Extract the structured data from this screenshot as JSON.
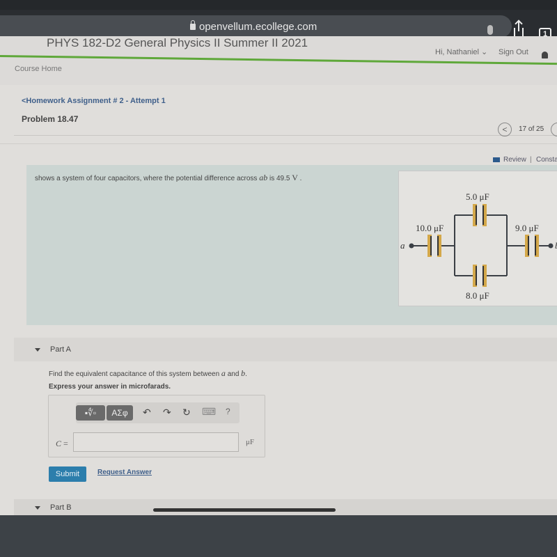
{
  "browser": {
    "url": "openvellum.ecollege.com",
    "tab_count": "1"
  },
  "header": {
    "course_title": "PHYS 182-D2 General Physics II Summer II 2021",
    "greeting": "Hi, Nathaniel ⌄",
    "sign_out": "Sign Out",
    "course_home": "Course Home",
    "accent_color": "#5fa83a"
  },
  "assignment": {
    "back_link": "<Homework Assignment # 2 - Attempt 1",
    "problem_title": "Problem 18.47",
    "pager": {
      "prev": "<",
      "position": "17 of 25"
    },
    "review_link": "Review",
    "separator": "|",
    "constants_link": "Consta"
  },
  "intro": {
    "text_before": "shows a system of four capacitors, where the potential difference across ",
    "var": "ab",
    "text_mid": " is 49.5 ",
    "unit": "V",
    "text_after": " ."
  },
  "figure": {
    "terminal_a": "a",
    "terminal_b": "b",
    "capacitors": [
      {
        "label": "10.0 μF",
        "position": "series-left"
      },
      {
        "label": "5.0 μF",
        "position": "parallel-top"
      },
      {
        "label": "8.0 μF",
        "position": "parallel-bottom"
      },
      {
        "label": "9.0 μF",
        "position": "series-right"
      }
    ]
  },
  "partA": {
    "label": "Part A",
    "question_before": "Find the equivalent capacitance of this system between ",
    "var_a": "a",
    "question_mid": " and ",
    "var_b": "b",
    "question_after": ".",
    "instruction": "Express your answer in microfarads.",
    "toolbar": {
      "templates": "▪∜▫",
      "symbols": "ΑΣφ",
      "undo": "↶",
      "redo": "↷",
      "reset": "↻",
      "keyboard": "⌨",
      "help": "?"
    },
    "input_label_var": "C",
    "input_label_eq": " =",
    "input_value": "",
    "unit": "μF",
    "submit": "Submit",
    "request_answer": "Request Answer"
  },
  "partB": {
    "label": "Part B"
  }
}
